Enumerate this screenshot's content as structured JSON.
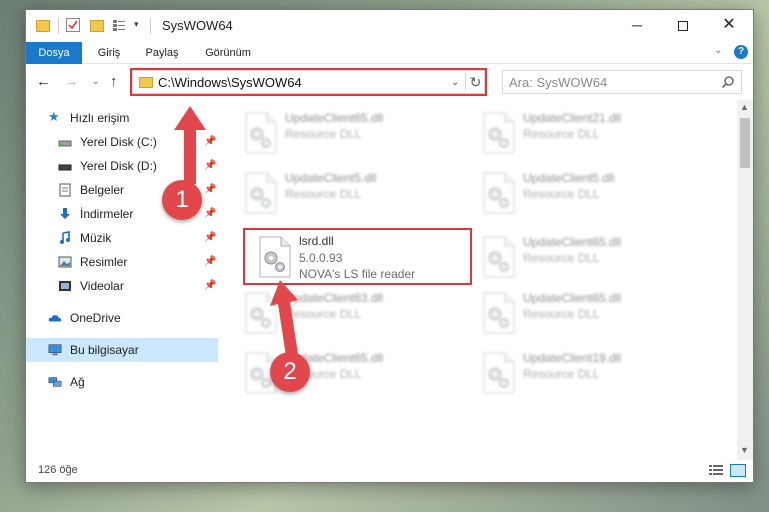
{
  "window": {
    "title": "SysWOW64",
    "controls": {
      "minimize": "─",
      "close": "✕"
    }
  },
  "ribbon": {
    "tabs": [
      "Dosya",
      "Giriş",
      "Paylaş",
      "Görünüm"
    ],
    "help": "?"
  },
  "nav": {
    "back": "←",
    "forward": "→",
    "recent": "⌄",
    "up": "↑",
    "address": "C:\\Windows\\SysWOW64",
    "address_dropdown": "⌄",
    "refresh": "↻",
    "search_placeholder": "Ara: SysWOW64"
  },
  "sidebar": {
    "items": [
      {
        "label": "Hızlı erişim",
        "icon": "star-icon"
      },
      {
        "label": "Yerel Disk (C:)",
        "icon": "drive-icon",
        "pinned": true
      },
      {
        "label": "Yerel Disk (D:)",
        "icon": "drive-icon",
        "pinned": true
      },
      {
        "label": "Belgeler",
        "icon": "documents-icon",
        "pinned": true
      },
      {
        "label": "İndirmeler",
        "icon": "download-icon",
        "pinned": true
      },
      {
        "label": "Müzik",
        "icon": "music-icon",
        "pinned": true
      },
      {
        "label": "Resimler",
        "icon": "pictures-icon",
        "pinned": true
      },
      {
        "label": "Videolar",
        "icon": "videos-icon",
        "pinned": true
      },
      {
        "label": "OneDrive",
        "icon": "cloud-icon"
      },
      {
        "label": "Bu bilgisayar",
        "icon": "computer-icon",
        "selected": true
      },
      {
        "label": "Ağ",
        "icon": "network-icon"
      }
    ],
    "pin_glyph": "📌"
  },
  "files": [
    {
      "name": "UpdateClient65.dll",
      "type": "Resource DLL",
      "blurred": true
    },
    {
      "name": "UpdateClient21.dll",
      "type": "Resource DLL",
      "blurred": true
    },
    {
      "name": "UpdateClient5.dll",
      "type": "Resource DLL",
      "blurred": true
    },
    {
      "name": "UpdateClient5.dll",
      "type": "Resource DLL",
      "blurred": true
    },
    {
      "name": "lsrd.dll",
      "version": "5.0.0.93",
      "description": "NOVA's LS file reader",
      "blurred": false
    },
    {
      "name": "UpdateClient65.dll",
      "type": "Resource DLL",
      "blurred": true
    },
    {
      "name": "UpdateClient63.dll",
      "type": "Resource DLL",
      "blurred": true
    },
    {
      "name": "UpdateClient65.dll",
      "type": "Resource DLL",
      "blurred": true
    },
    {
      "name": "UpdateClient65.dll",
      "type": "Resource DLL",
      "blurred": true
    },
    {
      "name": "UpdateClient19.dll",
      "type": "Resource DLL",
      "blurred": true
    }
  ],
  "status": {
    "item_count": "126 öğe"
  },
  "callouts": [
    "1",
    "2"
  ],
  "colors": {
    "accent": "#1979ca",
    "highlight": "#d9393e",
    "callout": "#e2474b",
    "selection": "#cce8ff"
  }
}
